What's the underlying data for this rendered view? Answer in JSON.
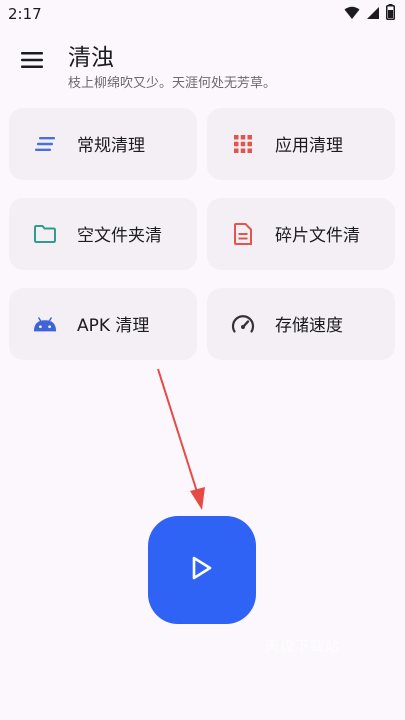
{
  "status_bar": {
    "time": "2:17"
  },
  "header": {
    "title": "清浊",
    "subtitle": "枝上柳绵吹又少。天涯何处无芳草。"
  },
  "cards": [
    {
      "label": "常规清理",
      "icon": "list-lines-icon",
      "color": "#4a6ee0"
    },
    {
      "label": "应用清理",
      "icon": "grid-dots-icon",
      "color": "#e0564f"
    },
    {
      "label": "空文件夹清",
      "icon": "folder-icon",
      "color": "#2f9c8c"
    },
    {
      "label": "碎片文件清",
      "icon": "document-icon",
      "color": "#e0564f"
    },
    {
      "label": "APK 清理",
      "icon": "android-icon",
      "color": "#3f63d8"
    },
    {
      "label": "存储速度",
      "icon": "speedometer-icon",
      "color": "#333333"
    }
  ],
  "play_button": {
    "icon": "play-icon",
    "color": "#2f63f5"
  },
  "annotation_arrow_color": "#e64a45",
  "watermark": "天极下载站"
}
